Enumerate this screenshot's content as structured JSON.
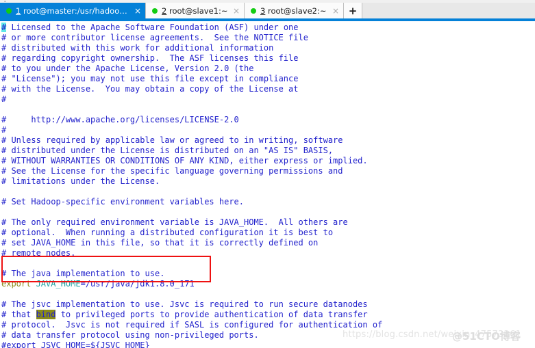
{
  "window": {
    "title": "root@master:/usr/hadoop/"
  },
  "tabbar": {
    "new_tab_label": "+",
    "close_glyph": "×",
    "tabs": [
      {
        "index": "1",
        "label": " root@master:/usr/hadoop/...",
        "full_label": "1 root@master:/usr/hadoop/...",
        "status": "connected",
        "active": true
      },
      {
        "index": "2",
        "label": " root@slave1:~",
        "full_label": "2 root@slave1:~",
        "status": "connected",
        "active": false
      },
      {
        "index": "3",
        "label": " root@slave2:~",
        "full_label": "3 root@slave2:~",
        "status": "connected",
        "active": false
      }
    ]
  },
  "terminal": {
    "cursor_char": "#",
    "lines": [
      {
        "id": "l01",
        "text": " Licensed to the Apache Software Foundation (ASF) under one",
        "cursor": true
      },
      {
        "id": "l02",
        "text": "# or more contributor license agreements.  See the NOTICE file"
      },
      {
        "id": "l03",
        "text": "# distributed with this work for additional information"
      },
      {
        "id": "l04",
        "text": "# regarding copyright ownership.  The ASF licenses this file"
      },
      {
        "id": "l05",
        "text": "# to you under the Apache License, Version 2.0 (the"
      },
      {
        "id": "l06",
        "text": "# \"License\"); you may not use this file except in compliance"
      },
      {
        "id": "l07",
        "text": "# with the License.  You may obtain a copy of the License at"
      },
      {
        "id": "l08",
        "text": "#"
      },
      {
        "id": "l09",
        "text": ""
      },
      {
        "id": "l10",
        "text": "#     http://www.apache.org/licenses/LICENSE-2.0"
      },
      {
        "id": "l11",
        "text": "#"
      },
      {
        "id": "l12",
        "text": "# Unless required by applicable law or agreed to in writing, software"
      },
      {
        "id": "l13",
        "text": "# distributed under the License is distributed on an \"AS IS\" BASIS,"
      },
      {
        "id": "l14",
        "text": "# WITHOUT WARRANTIES OR CONDITIONS OF ANY KIND, either express or implied."
      },
      {
        "id": "l15",
        "text": "# See the License for the specific language governing permissions and"
      },
      {
        "id": "l16",
        "text": "# limitations under the License."
      },
      {
        "id": "l17",
        "text": ""
      },
      {
        "id": "l18",
        "text": "# Set Hadoop-specific environment variables here."
      },
      {
        "id": "l19",
        "text": ""
      },
      {
        "id": "l20",
        "text": "# The only required environment variable is JAVA_HOME.  All others are"
      },
      {
        "id": "l21",
        "text": "# optional.  When running a distributed configuration it is best to"
      },
      {
        "id": "l22",
        "text": "# set JAVA_HOME in this file, so that it is correctly defined on"
      },
      {
        "id": "l23",
        "text": "# remote nodes."
      },
      {
        "id": "l24",
        "text": ""
      },
      {
        "id": "l25",
        "text": "# The java implementation to use."
      },
      {
        "id": "l26",
        "kind": "export",
        "export_keyword": "export",
        "var_name": " JAVA_HOME",
        "assign": "=/usr/java/jdk1.8.0_171"
      },
      {
        "id": "l27",
        "text": ""
      },
      {
        "id": "l28",
        "text": "# The jsvc implementation to use. Jsvc is required to run secure datanodes"
      },
      {
        "id": "l29",
        "kind": "highlight",
        "pre": "# that ",
        "match": "bind",
        "post": " to privileged ports to provide authentication of data transfer"
      },
      {
        "id": "l30",
        "text": "# protocol.  Jsvc is not required if SASL is configured for authentication of"
      },
      {
        "id": "l31",
        "text": "# data transfer protocol using non-privileged ports."
      },
      {
        "id": "l32",
        "text": "#export JSVC_HOME=${JSVC_HOME}"
      }
    ]
  },
  "annotation": {
    "redbox_label": "JAVA_HOME export highlighted"
  },
  "watermarks": {
    "csdn": "https://blog.csdn.net/weixin_47573261",
    "cto": "@51CTO博客"
  },
  "colors": {
    "accent": "#0481d8",
    "tab_active_bg": "#0481d8",
    "terminal_text": "#2222cc",
    "cursor_bg": "#5ee8e8",
    "search_hl_bg": "#8a8a18",
    "annotation_red": "#ee1111",
    "status_dot_green": "#12cc12"
  }
}
